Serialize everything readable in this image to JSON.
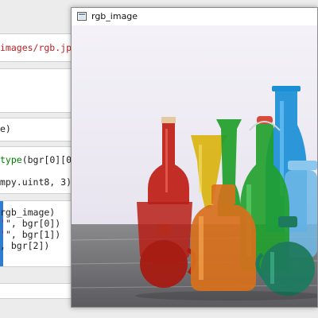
{
  "window": {
    "title": "rgb_image",
    "icon": "image-window-icon"
  },
  "editor": {
    "lines": {
      "path_string": "images/rgb.jpg",
      "line_e": "e)",
      "type_call": "type",
      "type_args": "(bgr[0][0",
      "dtype": "mpy.uint8, 3)",
      "imshow_arg": "rgb_image)",
      "bgr0_label": "\", bgr[0])",
      "bgr1_label": "\", bgr[1])",
      "bgr2_label": ", bgr[2])"
    }
  },
  "photo": {
    "subject": "colored glass bottles",
    "colors": {
      "red": "#c0241a",
      "orange": "#d8701c",
      "yellow": "#d9b20b",
      "green": "#1f9e2a",
      "blue": "#1a8fd6",
      "teal": "#1d7a5e",
      "light_blue": "#6fb8e6"
    }
  }
}
